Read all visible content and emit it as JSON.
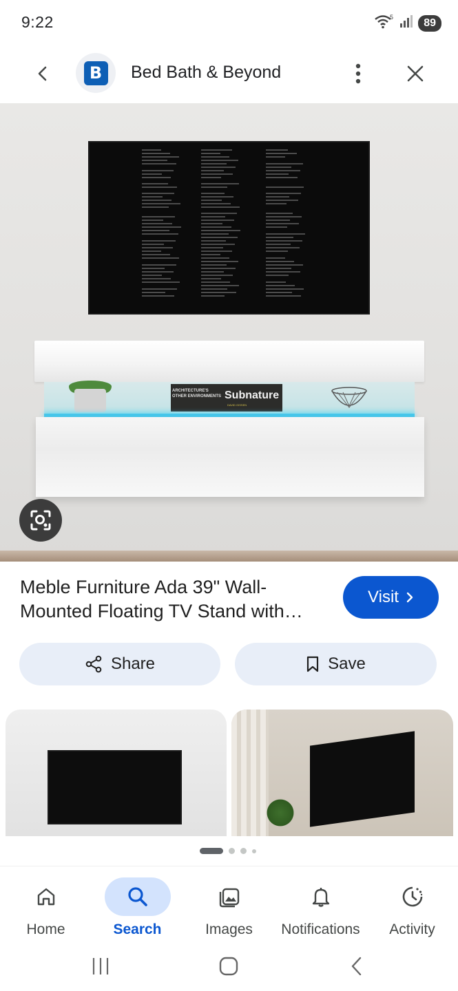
{
  "status_bar": {
    "time": "9:22",
    "battery": "89",
    "wifi_badge": "5"
  },
  "header": {
    "site_logo_letter": "B",
    "site_name": "Bed Bath & Beyond",
    "brand_color": "#0e5fb5"
  },
  "hero": {
    "book_title": "Subnature",
    "book_subtitle": "ARCHITECTURE'S OTHER ENVIRONMENTS",
    "book_spine_small": "DAVID GISSEN"
  },
  "product": {
    "title": "Meble Furniture Ada 39\" Wall-Mounted Floating TV Stand with…",
    "visit_label": "Visit",
    "accent_color": "#0b57d0"
  },
  "actions": {
    "share_label": "Share",
    "save_label": "Save"
  },
  "pager": {
    "total": 4,
    "active": 1
  },
  "bottom_nav": {
    "items": [
      {
        "label": "Home",
        "icon": "home-icon"
      },
      {
        "label": "Search",
        "icon": "search-icon",
        "active": true
      },
      {
        "label": "Images",
        "icon": "images-icon"
      },
      {
        "label": "Notifications",
        "icon": "bell-icon"
      },
      {
        "label": "Activity",
        "icon": "activity-icon"
      }
    ]
  }
}
